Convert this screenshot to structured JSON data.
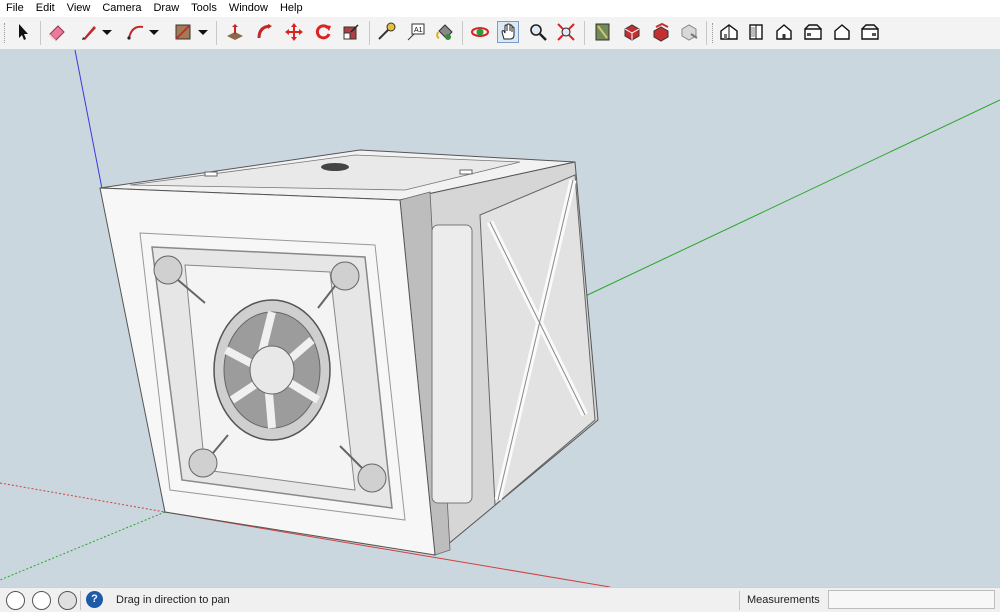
{
  "menu": [
    "File",
    "Edit",
    "View",
    "Camera",
    "Draw",
    "Tools",
    "Window",
    "Help"
  ],
  "toolbar": {
    "tools": [
      {
        "name": "select-tool",
        "icon": "arrow-cursor-icon"
      },
      {
        "name": "eraser-tool",
        "icon": "eraser-icon"
      },
      {
        "name": "line-tool",
        "icon": "pencil-icon"
      },
      {
        "name": "line-tool-dropdown",
        "icon": "dropdown-arrow-icon"
      },
      {
        "name": "arc-tool",
        "icon": "arc-icon"
      },
      {
        "name": "arc-tool-dropdown",
        "icon": "dropdown-arrow-icon"
      },
      {
        "name": "rectangle-tool",
        "icon": "rectangle-icon"
      },
      {
        "name": "rectangle-tool-dropdown",
        "icon": "dropdown-arrow-icon"
      },
      {
        "name": "push-pull-tool",
        "icon": "push-pull-icon"
      },
      {
        "name": "follow-me-tool",
        "icon": "follow-me-icon"
      },
      {
        "name": "move-tool",
        "icon": "move-icon"
      },
      {
        "name": "rotate-tool",
        "icon": "rotate-icon"
      },
      {
        "name": "scale-tool",
        "icon": "scale-icon"
      },
      {
        "name": "tape-measure-tool",
        "icon": "tape-measure-icon"
      },
      {
        "name": "text-tool",
        "icon": "text-icon"
      },
      {
        "name": "paint-bucket-tool",
        "icon": "paint-bucket-icon"
      },
      {
        "name": "orbit-tool",
        "icon": "orbit-icon"
      },
      {
        "name": "pan-tool",
        "icon": "hand-icon"
      },
      {
        "name": "zoom-tool",
        "icon": "magnifier-icon"
      },
      {
        "name": "zoom-extents-tool",
        "icon": "zoom-extents-icon"
      },
      {
        "name": "3d-warehouse-button",
        "icon": "map-book-icon"
      },
      {
        "name": "extension-warehouse-button",
        "icon": "red-box-icon"
      },
      {
        "name": "send-to-layout-button",
        "icon": "red-box-stack-icon"
      },
      {
        "name": "extension-manager-button",
        "icon": "gray-box-icon"
      },
      {
        "name": "iso-view-button",
        "icon": "iso-house-icon"
      },
      {
        "name": "top-view-button",
        "icon": "top-house-icon"
      },
      {
        "name": "front-view-button",
        "icon": "front-house-icon"
      },
      {
        "name": "right-view-button",
        "icon": "right-house-icon"
      },
      {
        "name": "back-view-button",
        "icon": "back-house-icon"
      },
      {
        "name": "left-view-button",
        "icon": "left-house-icon"
      }
    ],
    "active_tool": "pan-tool"
  },
  "status": {
    "hint": "Drag in direction to pan",
    "measurements_label": "Measurements",
    "measurements_value": ""
  },
  "colors": {
    "viewport_bg": "#cbd7de",
    "axis_red": "#d04040",
    "axis_green": "#2aa52a",
    "axis_blue": "#3a3adf",
    "model_face_light": "#f6f6f6",
    "model_face_mid": "#e4e4e4",
    "model_face_dark": "#b9b9b9"
  }
}
